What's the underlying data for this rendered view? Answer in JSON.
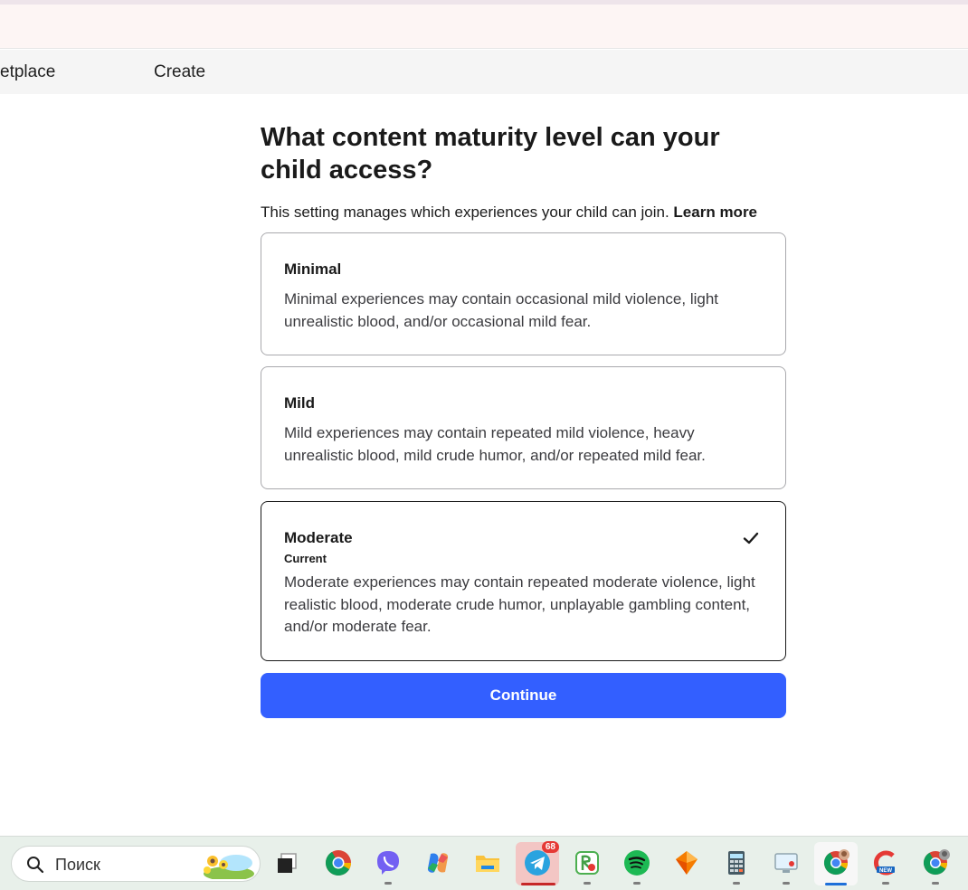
{
  "nav": {
    "items": [
      {
        "label": "etplace"
      },
      {
        "label": "Create"
      }
    ]
  },
  "page": {
    "heading": "What content maturity level can your child access?",
    "subtext": "This setting manages which experiences your child can join.",
    "learn_more": "Learn more"
  },
  "options": [
    {
      "title": "Minimal",
      "description": "Minimal experiences may contain occasional mild violence, light unrealistic blood, and/or occasional mild fear.",
      "selected": false
    },
    {
      "title": "Mild",
      "description": "Mild experiences may contain repeated mild violence, heavy unrealistic blood, mild crude humor, and/or repeated mild fear.",
      "selected": false
    },
    {
      "title": "Moderate",
      "current_label": "Current",
      "description": "Moderate experiences may contain repeated moderate violence, light realistic blood, moderate crude humor, unplayable gambling content, and/or moderate fear.",
      "selected": true
    }
  ],
  "continue_button": {
    "label": "Continue",
    "color": "#335fff"
  },
  "taskbar": {
    "search_placeholder": "Поиск",
    "telegram_badge": "68",
    "apps": [
      "task-view-icon",
      "chrome-icon",
      "viber-icon",
      "copilot-icon",
      "file-explorer-icon",
      "telegram-icon",
      "contacts-app-icon",
      "spotify-icon",
      "stack-app-icon",
      "calculator-icon",
      "screen-tool-icon",
      "chrome-profile-icon",
      "ccleaner-icon",
      "chrome-profile-2-icon"
    ]
  }
}
